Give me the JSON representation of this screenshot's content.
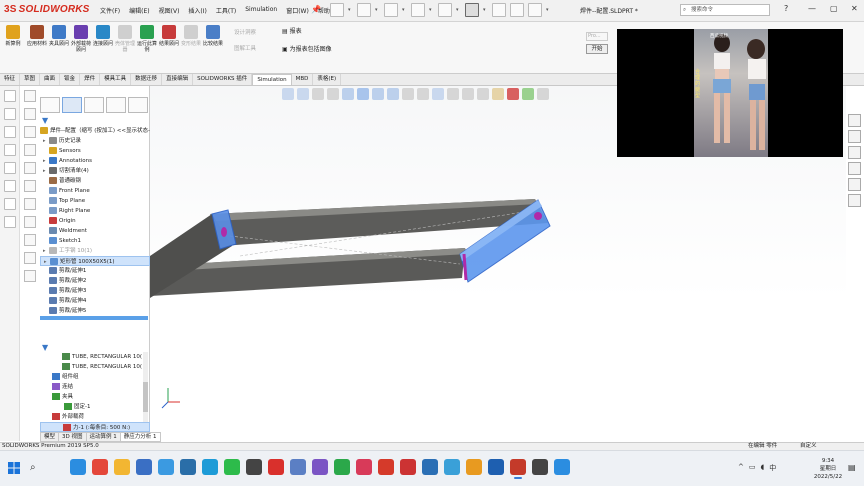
{
  "app": {
    "logo_ds": "3S",
    "logo_text": "SOLIDWORKS",
    "document_title": "焊件--配置.SLDPRT *",
    "search_placeholder": "搜索命令"
  },
  "menu": [
    "文件(F)",
    "编辑(E)",
    "视图(V)",
    "插入(I)",
    "工具(T)",
    "Simulation",
    "窗口(W)",
    "帮助(H)"
  ],
  "window_controls": {
    "help": "?",
    "minimize": "—",
    "restore": "▢",
    "close": "✕"
  },
  "ribbon": {
    "buttons": [
      {
        "label": "新算例",
        "dim": false,
        "color": "#e0a21d"
      },
      {
        "label": "应用材料",
        "dim": false,
        "color": "#a04b2a"
      },
      {
        "label": "夹具顾问",
        "dim": false,
        "color": "#3f7ac7"
      },
      {
        "label": "外部载荷顾问",
        "dim": false,
        "color": "#6a3fb0"
      },
      {
        "label": "连接顾问",
        "dim": false,
        "color": "#2a88c7"
      },
      {
        "label": "壳体管理器",
        "dim": true,
        "color": "#cfcfcf"
      },
      {
        "label": "运行此算例",
        "dim": false,
        "color": "#2aa150"
      },
      {
        "label": "结果顾问",
        "dim": false,
        "color": "#c73b3b"
      },
      {
        "label": "变形结果",
        "dim": true,
        "color": "#cfcfcf"
      },
      {
        "label": "比较结果",
        "dim": false,
        "color": "#4a7ec7"
      }
    ],
    "small": [
      "设计洞察",
      "图解工具"
    ],
    "report": "报表",
    "include_image": "为报表包括图像",
    "run_label": "开始",
    "run_input": "Pro..."
  },
  "command_tabs": [
    {
      "label": "特征",
      "active": false
    },
    {
      "label": "草图",
      "active": false
    },
    {
      "label": "曲面",
      "active": false
    },
    {
      "label": "钣金",
      "active": false
    },
    {
      "label": "焊件",
      "active": false
    },
    {
      "label": "模具工具",
      "active": false
    },
    {
      "label": "数据迁移",
      "active": false
    },
    {
      "label": "直接编辑",
      "active": false
    },
    {
      "label": "SOLIDWORKS 插件",
      "active": false
    },
    {
      "label": "Simulation",
      "active": true
    },
    {
      "label": "MBD",
      "active": false
    },
    {
      "label": "表格(E)",
      "active": false
    }
  ],
  "tree": {
    "root": "焊件--配置（缩写 (按加工) <<显示状态-1>>",
    "items": [
      {
        "label": "历史记录",
        "dim": false,
        "sel": false,
        "arrow": "▸",
        "color": "#8a8a8a"
      },
      {
        "label": "Sensors",
        "dim": false,
        "sel": false,
        "arrow": "",
        "color": "#d6a521"
      },
      {
        "label": "Annotations",
        "dim": false,
        "sel": false,
        "arrow": "▸",
        "color": "#3a78c7"
      },
      {
        "label": "切割清单(4)",
        "dim": false,
        "sel": false,
        "arrow": "▸",
        "color": "#6a6a6a"
      },
      {
        "label": "普通碳钢",
        "dim": false,
        "sel": false,
        "arrow": "",
        "color": "#9b6b45"
      },
      {
        "label": "Front Plane",
        "dim": false,
        "sel": false,
        "arrow": "",
        "color": "#7a9bc7"
      },
      {
        "label": "Top Plane",
        "dim": false,
        "sel": false,
        "arrow": "",
        "color": "#7a9bc7"
      },
      {
        "label": "Right Plane",
        "dim": false,
        "sel": false,
        "arrow": "",
        "color": "#7a9bc7"
      },
      {
        "label": "Origin",
        "dim": false,
        "sel": false,
        "arrow": "",
        "color": "#c73b3b"
      },
      {
        "label": "Weldment",
        "dim": false,
        "sel": false,
        "arrow": "",
        "color": "#6a8ab0"
      },
      {
        "label": "Sketch1",
        "dim": false,
        "sel": false,
        "arrow": "",
        "color": "#5a8fd1"
      },
      {
        "label": "工字钢 10(1)",
        "dim": true,
        "sel": false,
        "arrow": "▸",
        "color": "#b8b8b8"
      },
      {
        "label": "矩形管 100X50X5(1)",
        "dim": false,
        "sel": true,
        "arrow": "▸",
        "color": "#5a8fd1"
      },
      {
        "label": "剪裁/延伸1",
        "dim": false,
        "sel": false,
        "arrow": "",
        "color": "#5a7bb0"
      },
      {
        "label": "剪裁/延伸2",
        "dim": false,
        "sel": false,
        "arrow": "",
        "color": "#5a7bb0"
      },
      {
        "label": "剪裁/延伸3",
        "dim": false,
        "sel": false,
        "arrow": "",
        "color": "#5a7bb0"
      },
      {
        "label": "剪裁/延伸4",
        "dim": false,
        "sel": false,
        "arrow": "",
        "color": "#5a7bb0"
      },
      {
        "label": "剪裁/延伸5",
        "dim": false,
        "sel": false,
        "arrow": "",
        "color": "#5a7bb0"
      }
    ]
  },
  "study_tree": {
    "items": [
      {
        "label": "TUBE, RECTANGULAR 10(",
        "sel": false,
        "color": "#4a8a4a"
      },
      {
        "label": "TUBE, RECTANGULAR 10(",
        "sel": false,
        "color": "#4a8a4a"
      },
      {
        "label": "组件组",
        "sel": false,
        "color": "#3a78c7"
      },
      {
        "label": "连结",
        "sel": false,
        "color": "#8a5ac7"
      },
      {
        "label": "夹具",
        "sel": false,
        "color": "#3a9a3a"
      },
      {
        "label": "固定-1",
        "sel": false,
        "color": "#3a9a3a"
      },
      {
        "label": "外部载荷",
        "sel": false,
        "color": "#c73b3b"
      },
      {
        "label": "力-1 (:每条目: 500 N:)",
        "sel": true,
        "color": "#c73b3b"
      }
    ]
  },
  "model_tabs": [
    {
      "label": "模型",
      "active": false
    },
    {
      "label": "3D 视图",
      "active": false
    },
    {
      "label": "运动算例 1",
      "active": false
    },
    {
      "label": "静应力分析 1",
      "active": true
    }
  ],
  "status": {
    "left": "SOLIDWORKS Premium 2019 SP5.0",
    "mode": "在编辑 零件",
    "custom": "自定义"
  },
  "video": {
    "watermark": "西瓜视频",
    "caption": "合理的腿型"
  },
  "taskbar": {
    "apps": [
      {
        "name": "edge-icon",
        "color": "#2b8de0",
        "active": false
      },
      {
        "name": "chrome-icon",
        "color": "#e4473a",
        "active": false
      },
      {
        "name": "folder-icon",
        "color": "#f2b632",
        "active": false
      },
      {
        "name": "store-icon",
        "color": "#3a6fc4",
        "active": false
      },
      {
        "name": "mail-icon",
        "color": "#3b9ae1",
        "active": false
      },
      {
        "name": "photos-icon",
        "color": "#2a6ea8",
        "active": false
      },
      {
        "name": "video-icon",
        "color": "#1d9bd7",
        "active": false
      },
      {
        "name": "wechat-icon",
        "color": "#2dbb4b",
        "active": false
      },
      {
        "name": "terminal-icon",
        "color": "#444444",
        "active": false
      },
      {
        "name": "record-icon",
        "color": "#d9302c",
        "active": false
      },
      {
        "name": "paint-icon",
        "color": "#5b7fc4",
        "active": false
      },
      {
        "name": "game-icon",
        "color": "#7b55c4",
        "active": false
      },
      {
        "name": "chat-icon",
        "color": "#2ba84a",
        "active": false
      },
      {
        "name": "music-icon",
        "color": "#d83a59",
        "active": false
      },
      {
        "name": "browser-icon",
        "color": "#d53a2a",
        "active": false
      },
      {
        "name": "wps-icon",
        "color": "#cc3333",
        "active": false
      },
      {
        "name": "tool-icon",
        "color": "#2b6fb5",
        "active": false
      },
      {
        "name": "files-icon",
        "color": "#3aa0d8",
        "active": false
      },
      {
        "name": "sync-icon",
        "color": "#e89a20",
        "active": false
      },
      {
        "name": "settings-icon",
        "color": "#1e5fb0",
        "active": false
      },
      {
        "name": "solidworks-icon",
        "color": "#c43a2a",
        "active": true
      },
      {
        "name": "recorder-icon",
        "color": "#444444",
        "active": false
      },
      {
        "name": "media-icon",
        "color": "#2b8de0",
        "active": false
      }
    ],
    "time": "9:34",
    "weekday": "星期日",
    "date": "2022/5/22"
  }
}
